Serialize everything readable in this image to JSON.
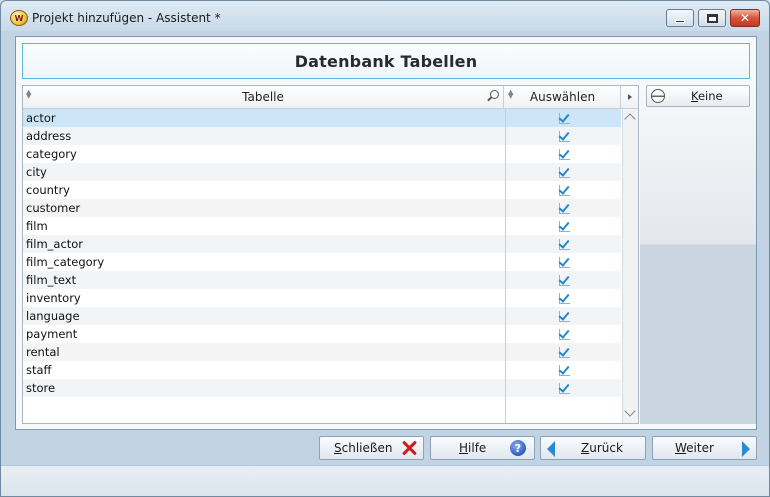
{
  "window": {
    "title": "Projekt hinzufügen - Assistent *",
    "app_icon_text": "W"
  },
  "header": {
    "title": "Datenbank Tabellen"
  },
  "grid": {
    "columns": [
      "Tabelle",
      "Auswählen"
    ],
    "rows": [
      {
        "name": "actor",
        "checked": true,
        "selected": true
      },
      {
        "name": "address",
        "checked": true
      },
      {
        "name": "category",
        "checked": true
      },
      {
        "name": "city",
        "checked": true
      },
      {
        "name": "country",
        "checked": true
      },
      {
        "name": "customer",
        "checked": true
      },
      {
        "name": "film",
        "checked": true
      },
      {
        "name": "film_actor",
        "checked": true
      },
      {
        "name": "film_category",
        "checked": true
      },
      {
        "name": "film_text",
        "checked": true
      },
      {
        "name": "inventory",
        "checked": true
      },
      {
        "name": "language",
        "checked": true
      },
      {
        "name": "payment",
        "checked": true
      },
      {
        "name": "rental",
        "checked": true
      },
      {
        "name": "staff",
        "checked": true
      },
      {
        "name": "store",
        "checked": true
      }
    ]
  },
  "side": {
    "none_label_prefix": "K",
    "none_label_rest": "eine"
  },
  "buttons": {
    "close_prefix": "S",
    "close_rest": "chließen",
    "help_prefix": "H",
    "help_rest": "ilfe",
    "back_prefix": "Z",
    "back_rest": "urück",
    "next_prefix": "W",
    "next_rest": "eiter",
    "help_icon_text": "?"
  },
  "colors": {
    "accent": "#2a8ccf",
    "selection": "#cde6f7",
    "close_red": "#d11a1a"
  }
}
